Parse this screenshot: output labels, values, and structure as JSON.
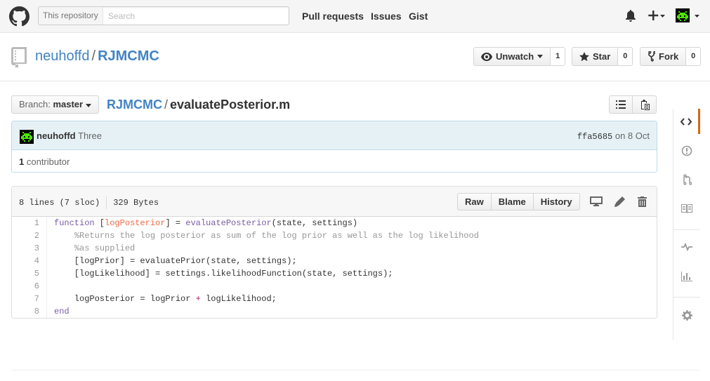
{
  "header": {
    "search_scope": "This repository",
    "search_placeholder": "Search",
    "nav": [
      "Pull requests",
      "Issues",
      "Gist"
    ]
  },
  "repo": {
    "owner": "neuhoffd",
    "separator": "/",
    "name": "RJMCMC",
    "unwatch_label": "Unwatch",
    "unwatch_count": "1",
    "star_label": "Star",
    "star_count": "0",
    "fork_label": "Fork",
    "fork_count": "0"
  },
  "file_nav": {
    "branch_prefix": "Branch:",
    "branch_name": "master",
    "breadcrumb_repo": "RJMCMC",
    "breadcrumb_sep": "/",
    "file_name": "evaluatePosterior.m"
  },
  "commit": {
    "author": "neuhoffd",
    "message": "Three",
    "sha": "ffa5685",
    "date_text": "on 8 Oct",
    "contributors_count": "1",
    "contributors_label": "contributor"
  },
  "file": {
    "lines_info": "8 lines (7 sloc)",
    "size": "329 Bytes",
    "raw_label": "Raw",
    "blame_label": "Blame",
    "history_label": "History",
    "line_numbers": [
      "1",
      "2",
      "3",
      "4",
      "5",
      "6",
      "7",
      "8"
    ]
  },
  "colors": {
    "link": "#4183c4",
    "keyword": "#795da3",
    "comment": "#969896",
    "variable": "#ed6a43",
    "operator": "#a71d5d",
    "active_tab": "#d26911"
  }
}
